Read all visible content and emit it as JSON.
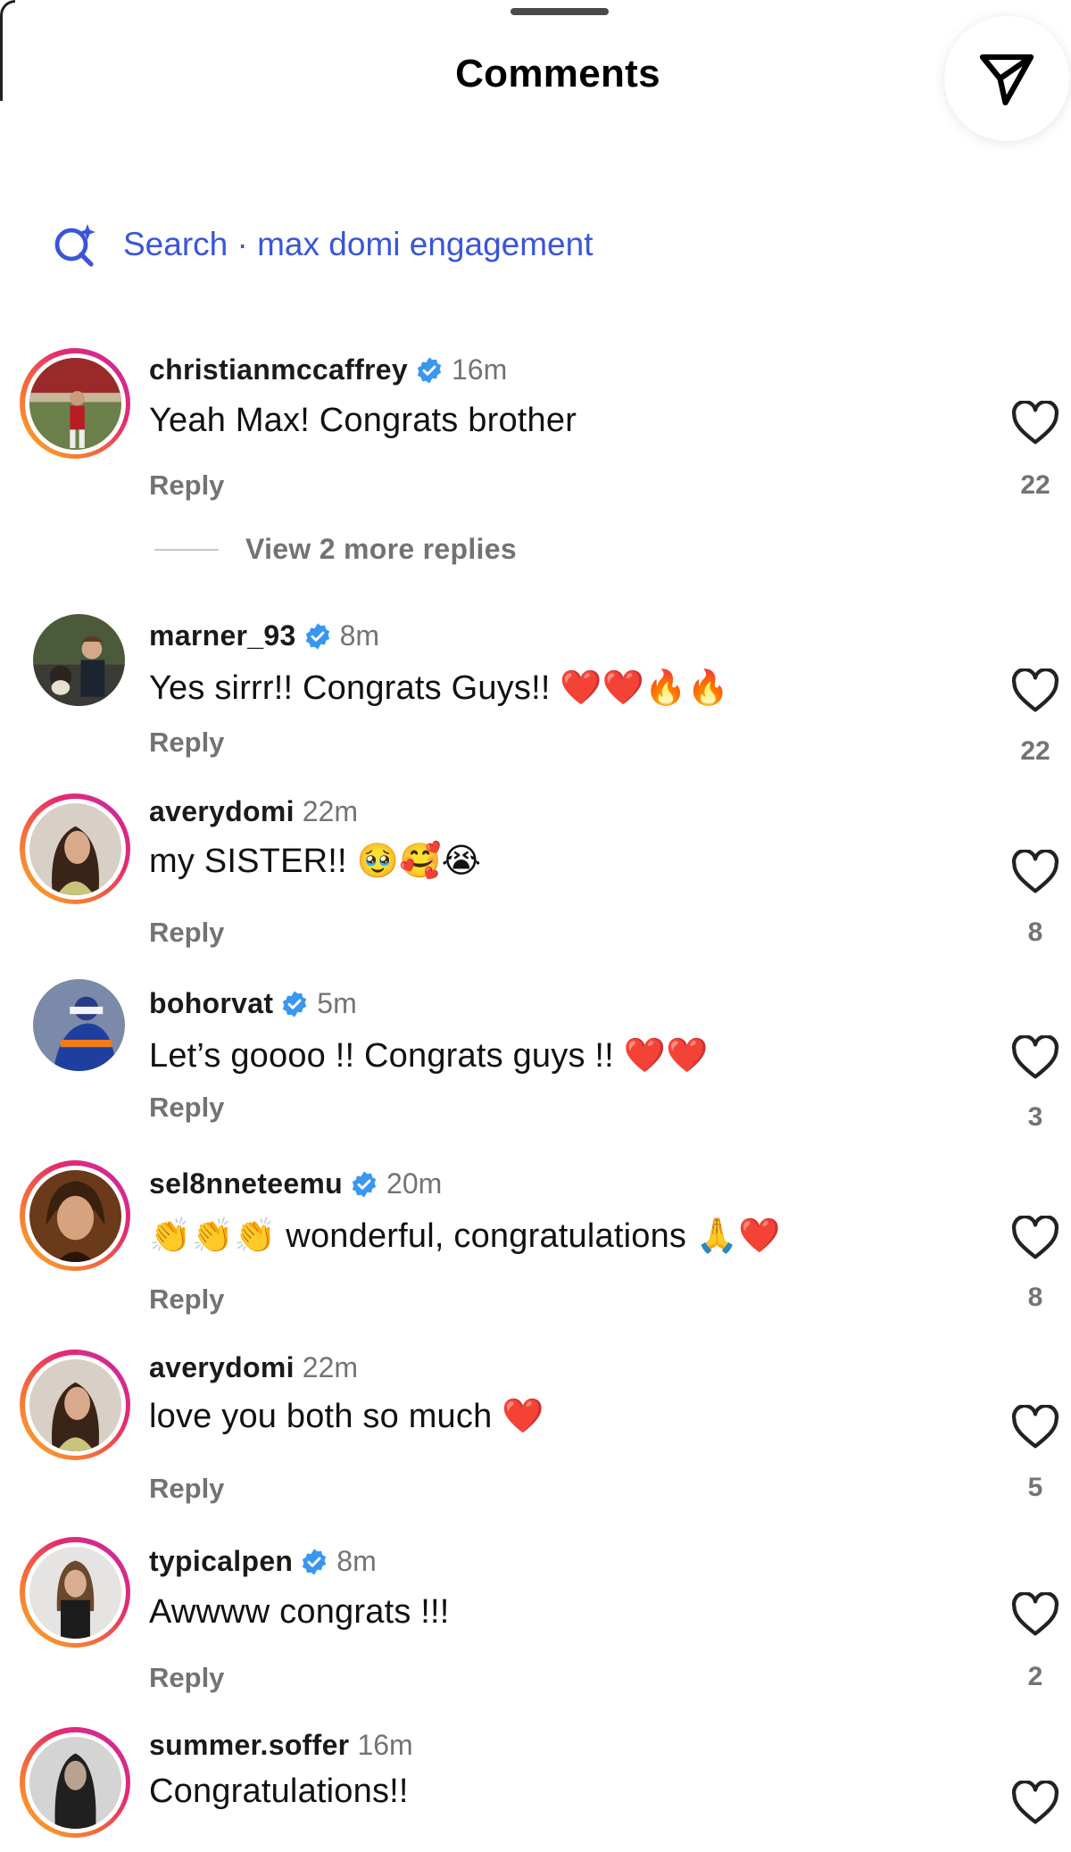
{
  "header": {
    "title": "Comments"
  },
  "search": {
    "label": "Search · max domi engagement"
  },
  "comments": [
    {
      "username": "christianmccaffrey",
      "verified": true,
      "time": "16m",
      "text": "Yeah Max! Congrats brother",
      "emojis": "",
      "reply_label": "Reply",
      "likes": "22",
      "view_more": "View 2 more replies"
    },
    {
      "username": "marner_93",
      "verified": true,
      "time": "8m",
      "text": "Yes sirrr!! Congrats Guys!! ",
      "emojis": "❤️❤️🔥🔥",
      "reply_label": "Reply",
      "likes": "22"
    },
    {
      "username": "averydomi",
      "verified": false,
      "time": "22m",
      "text": "my SISTER!! ",
      "emojis": "🥹🥰😭",
      "reply_label": "Reply",
      "likes": "8"
    },
    {
      "username": "bohorvat",
      "verified": true,
      "time": "5m",
      "text": "Let’s goooo !! Congrats guys !! ",
      "emojis": "❤️❤️",
      "reply_label": "Reply",
      "likes": "3"
    },
    {
      "username": "sel8nneteemu",
      "verified": true,
      "time": "20m",
      "emojis_before": "👏👏👏",
      "text": " wonderful, congratulations ",
      "emojis": "🙏❤️",
      "reply_label": "Reply",
      "likes": "8"
    },
    {
      "username": "averydomi",
      "verified": false,
      "time": "22m",
      "text": "love you both so much ",
      "emojis": "❤️",
      "reply_label": "Reply",
      "likes": "5"
    },
    {
      "username": "typicalpen",
      "verified": true,
      "time": "8m",
      "text": "Awwww congrats !!!",
      "emojis": "",
      "reply_label": "Reply",
      "likes": "2"
    },
    {
      "username": "summer.soffer",
      "verified": false,
      "time": "16m",
      "text": "Congratulations!!",
      "emojis": "",
      "reply_label": "",
      "likes": ""
    }
  ],
  "colors": {
    "accent": "#3a55d8",
    "verified": "#3897f0",
    "muted": "#737373"
  },
  "icons": [
    "share-icon",
    "ai-search-icon",
    "verified-badge-icon",
    "heart-icon"
  ]
}
